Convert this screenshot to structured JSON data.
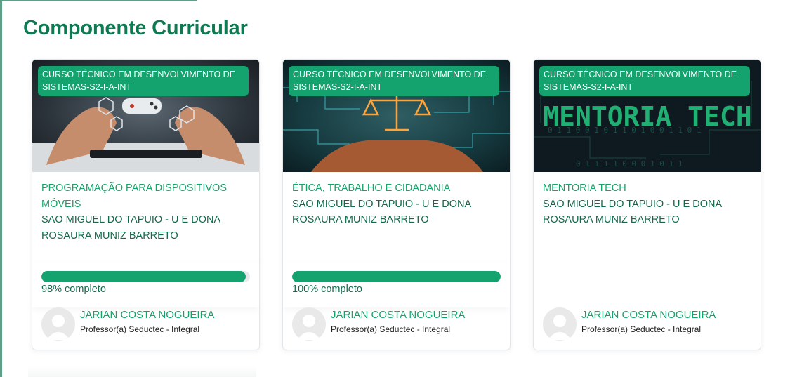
{
  "page": {
    "title": "Componente Curricular"
  },
  "theme": {
    "accent": "#14a36f",
    "title_color": "#0f7a52",
    "text_color": "#136a4a"
  },
  "cards": [
    {
      "badge": "CURSO TÉCNICO EM DESENVOLVIMENTO DE SISTEMAS-S2-I-A-INT",
      "subject": "PROGRAMAÇÃO PARA DISPOSITIVOS MÓVEIS",
      "school": "SAO MIGUEL DO TAPUIO - U E  DONA ROSAURA MUNIZ BARRETO",
      "progress": 98,
      "progress_label": "98% completo",
      "teacher_name": "JARIAN COSTA NOGUEIRA",
      "teacher_role": "Professor(a) Seductec - Integral",
      "image": "hands-holding-phone-game-icons"
    },
    {
      "badge": "CURSO TÉCNICO EM DESENVOLVIMENTO DE SISTEMAS-S2-I-A-INT",
      "subject": "ÉTICA, TRABALHO E CIDADANIA",
      "school": "SAO MIGUEL DO TAPUIO - U E  DONA ROSAURA MUNIZ BARRETO",
      "progress": 100,
      "progress_label": "100% completo",
      "teacher_name": "JARIAN COSTA NOGUEIRA",
      "teacher_role": "Professor(a) Seductec - Integral",
      "image": "scales-of-justice-circuit"
    },
    {
      "badge": "CURSO TÉCNICO EM DESENVOLVIMENTO DE SISTEMAS-S2-I-A-INT",
      "subject": "MENTORIA TECH",
      "school": "SAO MIGUEL DO TAPUIO - U E  DONA ROSAURA MUNIZ BARRETO",
      "banner_text": "MENTORIA TECH",
      "teacher_name": "JARIAN COSTA NOGUEIRA",
      "teacher_role": "Professor(a) Seductec - Integral",
      "image": "binary-circuit-background"
    }
  ]
}
